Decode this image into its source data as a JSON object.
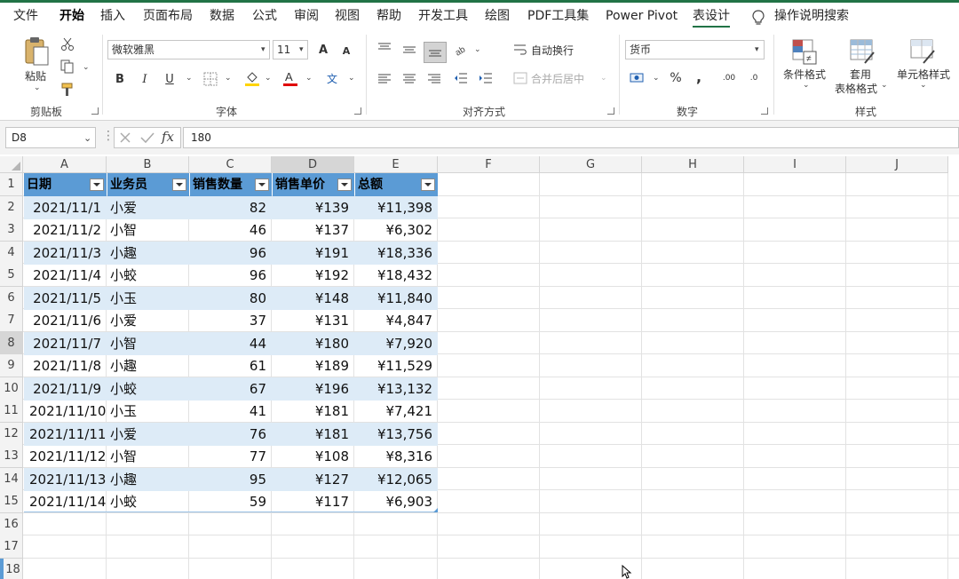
{
  "menu": {
    "tabs": [
      "文件",
      "开始",
      "插入",
      "页面布局",
      "数据",
      "公式",
      "审阅",
      "视图",
      "帮助",
      "开发工具",
      "绘图",
      "PDF工具集",
      "Power Pivot",
      "表设计"
    ],
    "search": "操作说明搜索"
  },
  "ribbon": {
    "clipboard": {
      "paste": "粘贴",
      "label": "剪贴板"
    },
    "font": {
      "name": "微软雅黑",
      "size": "11",
      "bold": "B",
      "italic": "I",
      "underline": "U",
      "label": "字体",
      "grow": "A",
      "shrink": "A",
      "phonetic": "文"
    },
    "alignment": {
      "wrap": "自动换行",
      "merge": "合并后居中",
      "label": "对齐方式"
    },
    "number": {
      "format": "货币",
      "percent": "%",
      "comma": ",",
      "label": "数字",
      "inc": ".00",
      "dec": ".0"
    },
    "styles": {
      "conditional": "条件格式",
      "table_line1": "套用",
      "table_line2": "表格格式",
      "cell": "单元格样式",
      "label": "样式"
    }
  },
  "formula": {
    "namebox": "D8",
    "value": "180",
    "fx": "fx"
  },
  "colors": {
    "accent": "#217346",
    "table_header": "#5b9bd5",
    "table_band": "#ddebf7"
  },
  "columns": [
    "A",
    "B",
    "C",
    "D",
    "E",
    "F",
    "G",
    "H",
    "I",
    "J"
  ],
  "rows": [
    "1",
    "2",
    "3",
    "4",
    "5",
    "6",
    "7",
    "8",
    "9",
    "10",
    "11",
    "12",
    "13",
    "14",
    "15",
    "16",
    "17",
    "18"
  ],
  "table": {
    "headers": [
      "日期",
      "业务员",
      "销售数量",
      "销售单价",
      "总额"
    ],
    "rows": [
      [
        "2021/11/1",
        "小爱",
        "82",
        "¥139",
        "¥11,398"
      ],
      [
        "2021/11/2",
        "小智",
        "46",
        "¥137",
        "¥6,302"
      ],
      [
        "2021/11/3",
        "小趣",
        "96",
        "¥191",
        "¥18,336"
      ],
      [
        "2021/11/4",
        "小蛟",
        "96",
        "¥192",
        "¥18,432"
      ],
      [
        "2021/11/5",
        "小玉",
        "80",
        "¥148",
        "¥11,840"
      ],
      [
        "2021/11/6",
        "小爱",
        "37",
        "¥131",
        "¥4,847"
      ],
      [
        "2021/11/7",
        "小智",
        "44",
        "¥180",
        "¥7,920"
      ],
      [
        "2021/11/8",
        "小趣",
        "61",
        "¥189",
        "¥11,529"
      ],
      [
        "2021/11/9",
        "小蛟",
        "67",
        "¥196",
        "¥13,132"
      ],
      [
        "2021/11/10",
        "小玉",
        "41",
        "¥181",
        "¥7,421"
      ],
      [
        "2021/11/11",
        "小爱",
        "76",
        "¥181",
        "¥13,756"
      ],
      [
        "2021/11/12",
        "小智",
        "77",
        "¥108",
        "¥8,316"
      ],
      [
        "2021/11/13",
        "小趣",
        "95",
        "¥127",
        "¥12,065"
      ],
      [
        "2021/11/14",
        "小蛟",
        "59",
        "¥117",
        "¥6,903"
      ]
    ]
  }
}
